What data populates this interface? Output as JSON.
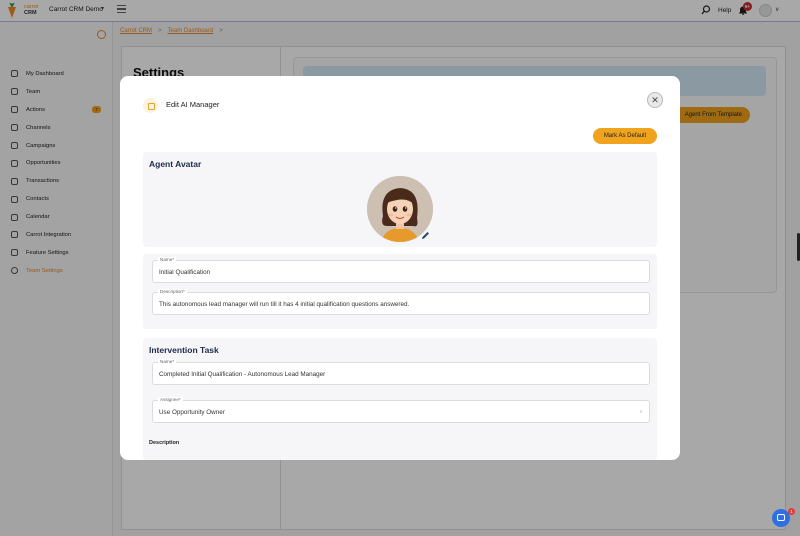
{
  "topbar": {
    "logo_line1": "carrot",
    "logo_line2": "CRM",
    "workspace": "Carrot CRM Demo",
    "help": "Help",
    "notification_count": "9+"
  },
  "sidebar": {
    "items": [
      {
        "label": "My Dashboard",
        "icon": "grid-icon"
      },
      {
        "label": "Team",
        "icon": "team-icon"
      },
      {
        "label": "Actions",
        "icon": "check-circle-icon",
        "badge": "7"
      },
      {
        "label": "Channels",
        "icon": "channels-icon"
      },
      {
        "label": "Campaigns",
        "icon": "megaphone-icon"
      },
      {
        "label": "Opportunities",
        "icon": "home-icon"
      },
      {
        "label": "Transactions",
        "icon": "transactions-icon"
      },
      {
        "label": "Contacts",
        "icon": "contacts-icon"
      },
      {
        "label": "Calendar",
        "icon": "calendar-icon"
      },
      {
        "label": "Carrot Integration",
        "icon": "integration-icon"
      },
      {
        "label": "Feature Settings",
        "icon": "feature-settings-icon"
      },
      {
        "label": "Team Settings",
        "icon": "gear-icon",
        "active": true
      }
    ]
  },
  "breadcrumb": {
    "item1": "Carrot CRM",
    "sep": ">",
    "item2": "Team Dashboard",
    "sep2": ">"
  },
  "page": {
    "title": "Settings",
    "template_button": "Agent From Template"
  },
  "modal": {
    "title": "Edit AI Manager",
    "mark_default": "Mark As Default",
    "avatar_section_title": "Agent Avatar",
    "name_label": "Name*",
    "name_value": "Initial Qualification",
    "description_label": "Description*",
    "description_value": "This autonomous lead manager will run till it has 4 initial qualification questions answered.",
    "task_section_title": "Intervention Task",
    "task_name_label": "Name*",
    "task_name_value": "Completed Initial Qualification - Autonomous Lead Manager",
    "assignee_label": "Assignee*",
    "assignee_value": "Use Opportunity Owner",
    "task_description_label": "Description"
  },
  "chat": {
    "badge": "1"
  },
  "colors": {
    "accent": "#f0a31d",
    "link": "#e8892c",
    "heading": "#1d2a4a"
  }
}
